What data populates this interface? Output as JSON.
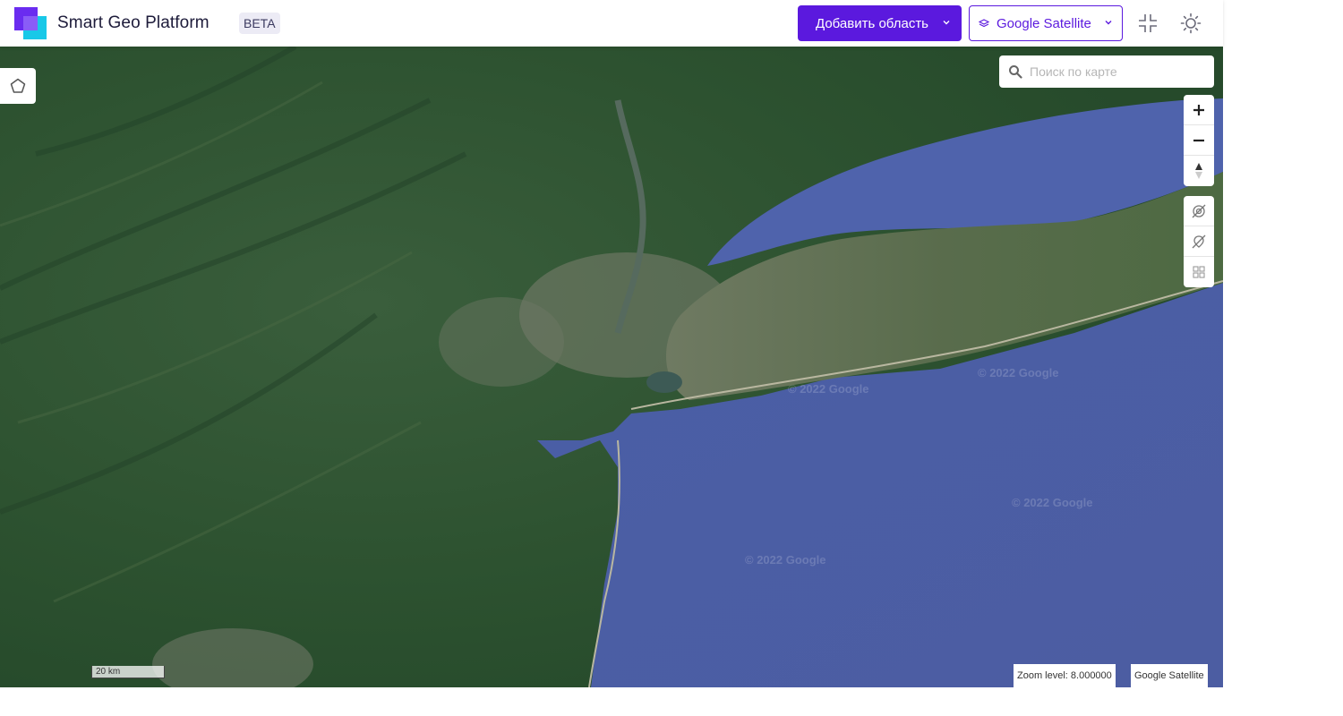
{
  "header": {
    "app_title": "Smart Geo Platform",
    "beta_badge": "BETA",
    "add_area_label": "Добавить область",
    "layer_label": "Google Satellite"
  },
  "map": {
    "search_placeholder": "Поиск по карте",
    "watermark": "© 2022 Google",
    "scale_label": "20 km",
    "zoom_label": "Zoom level: 8.000000",
    "layer_attribution": "Google Satellite"
  },
  "colors": {
    "brand": "#5b19de",
    "logo_cyan": "#18c8e8",
    "water": "#4f62a8",
    "land": "#2f5a36"
  },
  "icons": [
    "polygon-draw-icon",
    "search-icon",
    "zoom-in-icon",
    "zoom-out-icon",
    "compass-icon",
    "hide-features-icon",
    "hide-points-icon",
    "grid-icon",
    "layers-icon",
    "collapse-icon",
    "theme-sun-icon",
    "chevron-down-icon"
  ]
}
